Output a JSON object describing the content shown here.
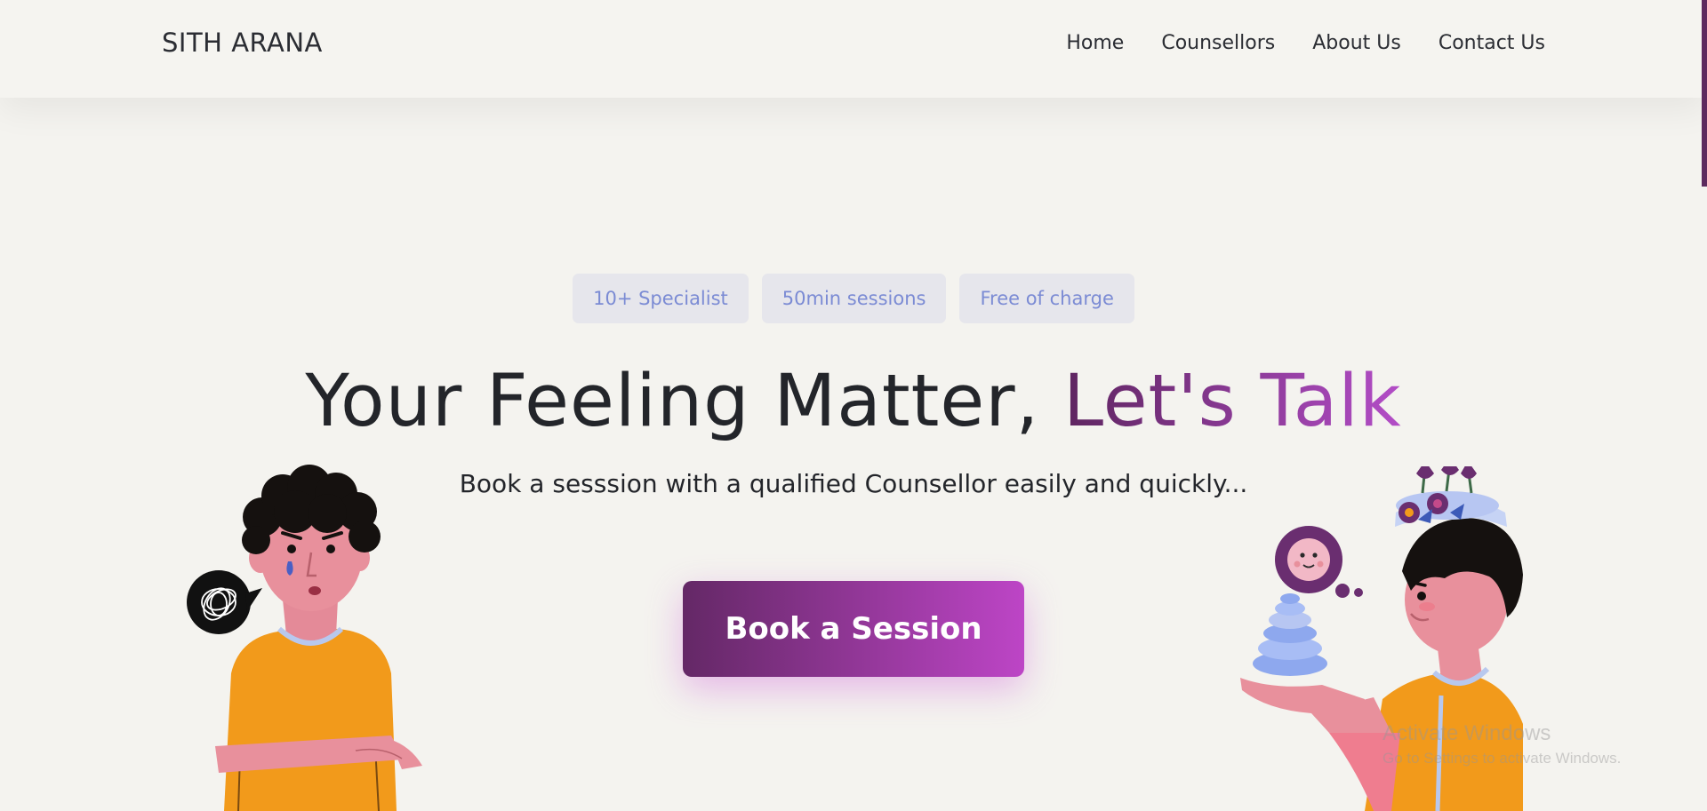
{
  "brand": {
    "name": "SITH ARANA"
  },
  "nav": {
    "items": [
      {
        "label": "Home"
      },
      {
        "label": "Counsellors"
      },
      {
        "label": "About Us"
      },
      {
        "label": "Contact Us"
      }
    ]
  },
  "hero": {
    "pills": [
      {
        "label": "10+ Specialist"
      },
      {
        "label": "50min sessions"
      },
      {
        "label": "Free of charge"
      }
    ],
    "headline": {
      "main": "Your Feeling Matter, ",
      "accent": "Let's Talk"
    },
    "subtitle": "Book a sesssion with a qualified Counsellor easily and quickly...",
    "cta_label": "Book a Session"
  },
  "watermark": {
    "title": "Activate Windows",
    "subtitle": "Go to Settings to activate Windows."
  },
  "colors": {
    "background": "#f4f3ef",
    "accent_start": "#5e2560",
    "accent_end": "#b34dc7",
    "pill_bg": "#e6e6ec",
    "pill_text": "#7b8bd4",
    "text": "#23252a"
  },
  "icons": {
    "left_illustration": "sad-person-illustration",
    "right_illustration": "calm-person-illustration"
  }
}
